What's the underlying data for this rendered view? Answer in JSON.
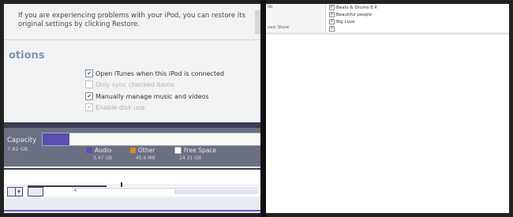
{
  "settings_panel": {
    "restore_message": "If you are experiencing problems with your iPod, you can restore its original settings by clicking Restore.",
    "options_heading": "otions",
    "options": [
      {
        "label": "Open iTunes when this iPod is connected",
        "checked": true,
        "enabled": true
      },
      {
        "label": "Only sync checked items",
        "checked": false,
        "enabled": false
      },
      {
        "label": "Manually manage music and videos",
        "checked": true,
        "enabled": true
      },
      {
        "label": "Enable disk use",
        "checked": true,
        "enabled": false
      }
    ],
    "capacity": {
      "label": "Capacity",
      "value": "7.82 GB",
      "legend": [
        {
          "name": "Audio",
          "value": "3.47 GB",
          "color": "#5a4fb0"
        },
        {
          "name": "Other",
          "value": "45.9 MB",
          "color": "#e08a1e"
        },
        {
          "name": "Free Space",
          "value": "24.31 GB",
          "color": "#ffffff"
        }
      ]
    }
  },
  "music_panel": {
    "side_rows": [
      "lib",
      "",
      "",
      "usic Store"
    ],
    "items": [
      {
        "label": "Beats & Drums E.P.",
        "checked": true
      },
      {
        "label": "Beautiful people",
        "checked": true
      },
      {
        "label": "Big Love",
        "checked": true
      },
      {
        "label": "",
        "checked": true
      }
    ]
  }
}
